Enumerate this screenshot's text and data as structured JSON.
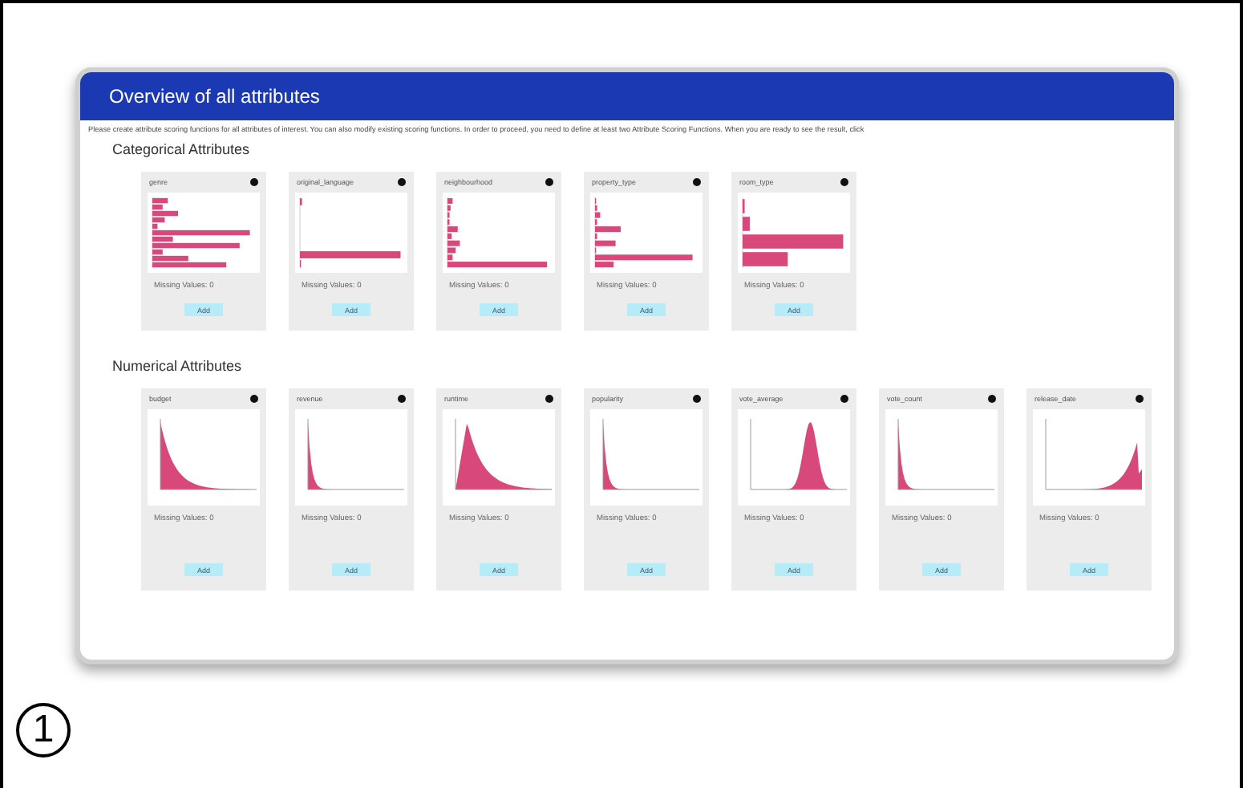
{
  "figure_label": "1",
  "window": {
    "title": "Overview of all attributes"
  },
  "description": "Please create attribute scoring functions for all attributes of interest. You can also modify existing scoring functions. In order to proceed, you need to define at least two Attribute Scoring Functions. When you are ready to see the result, click",
  "sections": [
    {
      "title": "Categorical Attributes",
      "kind": "categorical",
      "cards": [
        {
          "name": "genre",
          "kind": "many",
          "missing": "Missing Values: 0",
          "button": "Add"
        },
        {
          "name": "original_language",
          "kind": "single",
          "missing": "Missing Values: 0",
          "button": "Add"
        },
        {
          "name": "neighbourhood",
          "kind": "longtail",
          "missing": "Missing Values: 0",
          "button": "Add"
        },
        {
          "name": "property_type",
          "kind": "sparse",
          "missing": "Missing Values: 0",
          "button": "Add"
        },
        {
          "name": "room_type",
          "kind": "few",
          "missing": "Missing Values: 0",
          "button": "Add"
        }
      ]
    },
    {
      "title": "Numerical Attributes",
      "kind": "numerical",
      "cards": [
        {
          "name": "budget",
          "kind": "decay",
          "missing": "Missing Values: 0",
          "button": "Add"
        },
        {
          "name": "revenue",
          "kind": "spike",
          "missing": "Missing Values: 0",
          "button": "Add"
        },
        {
          "name": "runtime",
          "kind": "hump",
          "missing": "Missing Values: 0",
          "button": "Add"
        },
        {
          "name": "popularity",
          "kind": "spike",
          "missing": "Missing Values: 0",
          "button": "Add"
        },
        {
          "name": "vote_average",
          "kind": "bell",
          "missing": "Missing Values: 0",
          "button": "Add"
        },
        {
          "name": "vote_count",
          "kind": "spike",
          "missing": "Missing Values: 0",
          "button": "Add"
        },
        {
          "name": "release_date",
          "kind": "rise",
          "missing": "Missing Values: 0",
          "button": "Add"
        }
      ]
    }
  ]
}
